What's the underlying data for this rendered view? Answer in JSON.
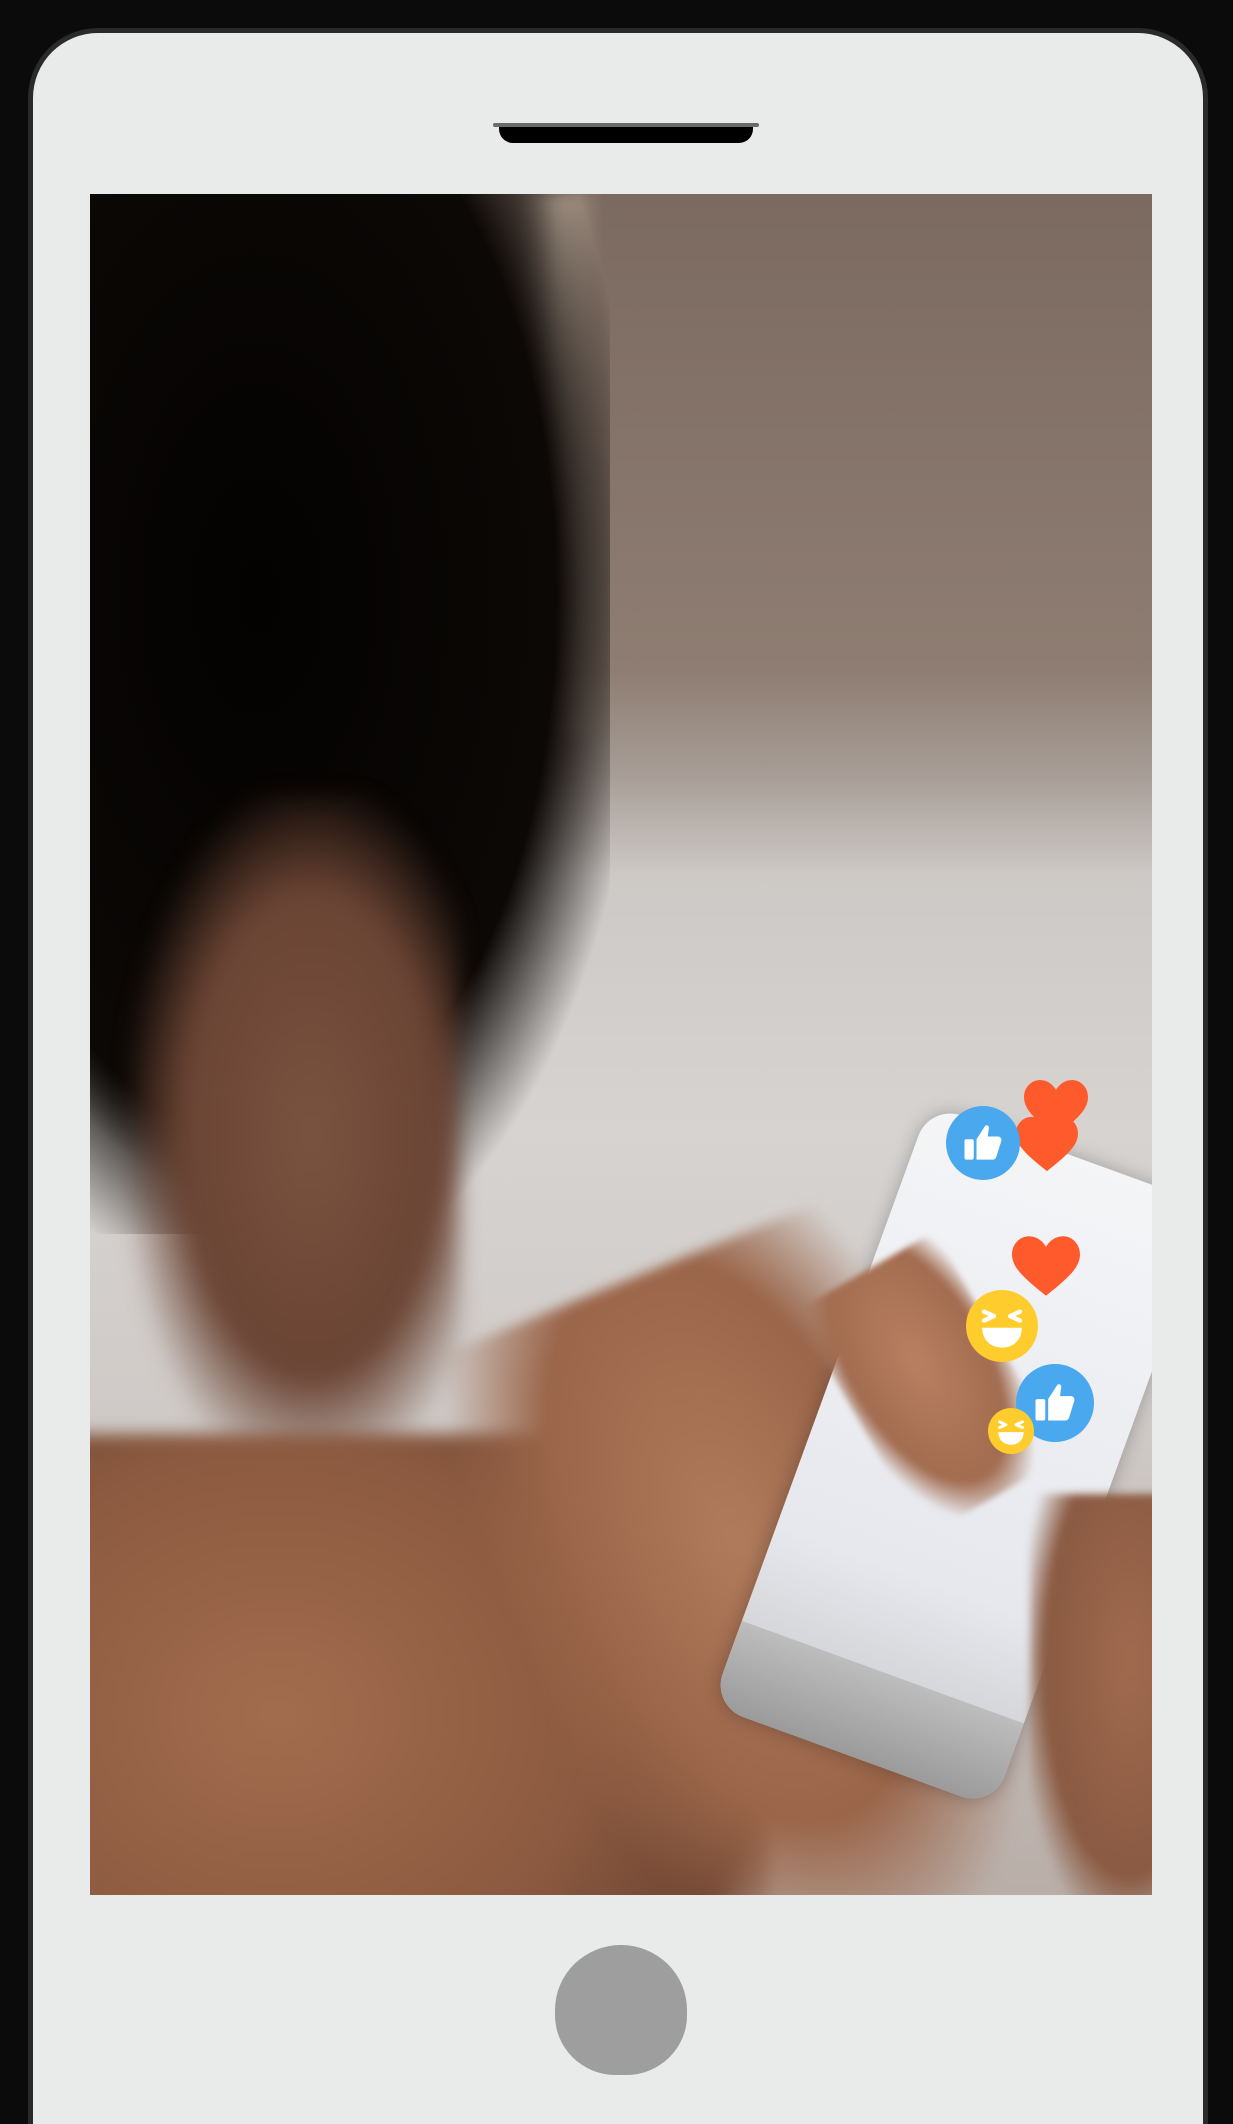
{
  "device": {
    "type": "smartphone-frame",
    "body_color": "#e9eaea",
    "frame_color": "#2a2a2a",
    "home_button_color": "#9e9e9e"
  },
  "screen": {
    "content": "photo",
    "reactions": [
      {
        "icon": "heart-icon",
        "color": "#ff5a2c"
      },
      {
        "icon": "heart-icon",
        "color": "#ff5a2c"
      },
      {
        "icon": "thumbs-up-icon",
        "color": "#4aa8ef"
      },
      {
        "icon": "heart-icon",
        "color": "#ff5a2c"
      },
      {
        "icon": "laughing-face-icon",
        "color": "#ffcc2e"
      },
      {
        "icon": "thumbs-up-icon",
        "color": "#4aa8ef"
      },
      {
        "icon": "laughing-face-icon",
        "color": "#ffcc2e"
      }
    ]
  }
}
